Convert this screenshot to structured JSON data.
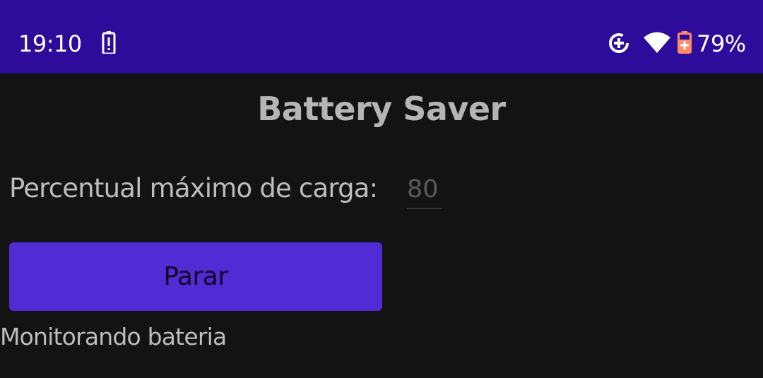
{
  "status_bar": {
    "time": "19:10",
    "battery_percent": "79%",
    "icons": [
      "battery-alert-icon",
      "data-saver-icon",
      "wifi-icon",
      "battery-charging-icon"
    ],
    "background_color": "#2d0b9b"
  },
  "app": {
    "title": "Battery Saver",
    "max_charge": {
      "label": "Percentual máximo de carga:",
      "placeholder": "80",
      "value": ""
    },
    "action_button": {
      "label": "Parar",
      "color": "#512bd4"
    },
    "status_message": "Monitorando bateria"
  }
}
